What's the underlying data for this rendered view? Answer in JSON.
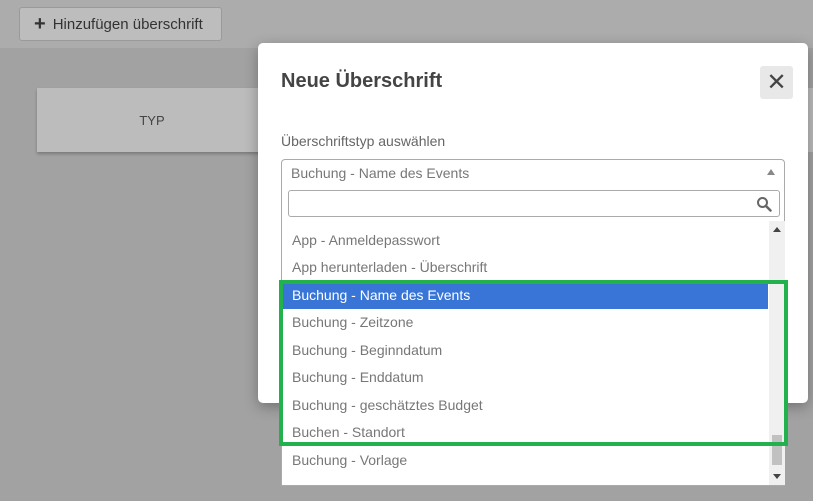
{
  "toolbar": {
    "add_button_label": "Hinzufügen überschrift",
    "add_button_icon": "plus-icon"
  },
  "table": {
    "column_header": "TYP"
  },
  "modal": {
    "title": "Neue Überschrift",
    "close_icon": "close-icon",
    "field_label": "Überschriftstyp auswählen",
    "select": {
      "selected_value": "Buchung - Name des Events",
      "search_value": "",
      "options": [
        "App - Anmeldepasswort",
        "App herunterladen - Überschrift",
        "Buchung - Name des Events",
        "Buchung - Zeitzone",
        "Buchung - Beginndatum",
        "Buchung - Enddatum",
        "Buchung - geschätztes Budget",
        "Buchen - Standort",
        "Buchung - Vorlage"
      ],
      "highlighted_option": "Buchung - Name des Events"
    }
  },
  "colors": {
    "selected_option": "#3875d7",
    "annotation_box": "#22b14c",
    "overlay": "#a2a2a2"
  }
}
